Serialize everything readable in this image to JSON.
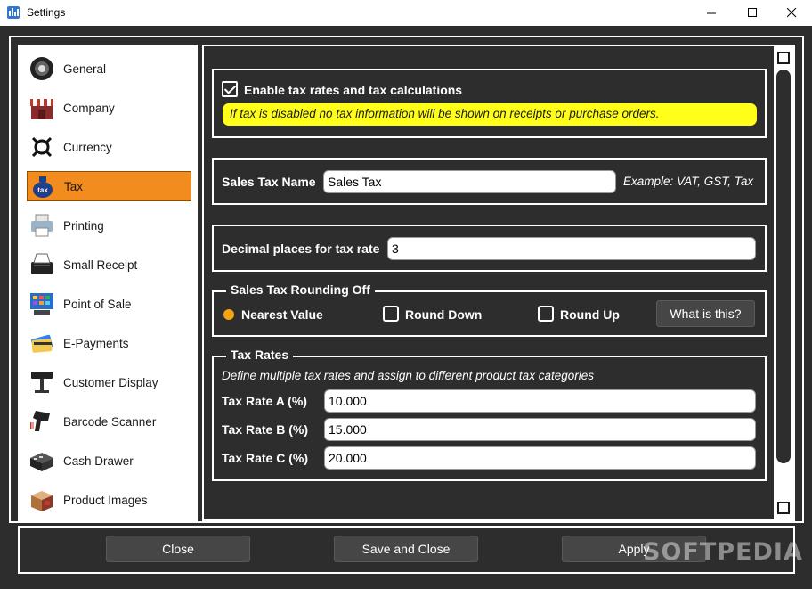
{
  "window": {
    "title": "Settings"
  },
  "sidebar": {
    "items": [
      {
        "label": "General",
        "icon": "speaker-icon"
      },
      {
        "label": "Company",
        "icon": "storefront-icon"
      },
      {
        "label": "Currency",
        "icon": "currency-icon"
      },
      {
        "label": "Tax",
        "icon": "tax-bag-icon",
        "active": true
      },
      {
        "label": "Printing",
        "icon": "printer-icon"
      },
      {
        "label": "Small Receipt",
        "icon": "receipt-printer-icon"
      },
      {
        "label": "Point of Sale",
        "icon": "pos-terminal-icon"
      },
      {
        "label": "E-Payments",
        "icon": "credit-cards-icon"
      },
      {
        "label": "Customer Display",
        "icon": "pole-display-icon"
      },
      {
        "label": "Barcode Scanner",
        "icon": "barcode-scanner-icon"
      },
      {
        "label": "Cash Drawer",
        "icon": "cash-drawer-icon"
      },
      {
        "label": "Product Images",
        "icon": "product-box-icon"
      }
    ]
  },
  "tax": {
    "enable_label": "Enable tax rates and tax calculations",
    "enable_checked": true,
    "warning": "If tax is disabled no tax information will be shown on receipts or purchase orders.",
    "sales_tax_name_label": "Sales Tax Name",
    "sales_tax_name_value": "Sales Tax",
    "sales_tax_name_example": "Example: VAT, GST, Tax",
    "decimal_places_label": "Decimal places for tax rate",
    "decimal_places_value": "3",
    "rounding": {
      "legend": "Sales Tax Rounding Off",
      "options": [
        "Nearest Value",
        "Round Down",
        "Round Up"
      ],
      "selected": "Nearest Value",
      "help_button": "What is this?"
    },
    "rates": {
      "legend": "Tax Rates",
      "description": "Define multiple tax rates and assign to different product tax categories",
      "items": [
        {
          "label": "Tax Rate A (%)",
          "value": "10.000"
        },
        {
          "label": "Tax Rate B (%)",
          "value": "15.000"
        },
        {
          "label": "Tax Rate C (%)",
          "value": "20.000"
        }
      ]
    }
  },
  "footer": {
    "close": "Close",
    "save_close": "Save and Close",
    "apply": "Apply",
    "watermark": "SOFTPEDIA"
  },
  "colors": {
    "background": "#2d2d2d",
    "active_item": "#f28c1e",
    "warning": "#ffff1a",
    "radio_selected": "#f5a30f"
  }
}
